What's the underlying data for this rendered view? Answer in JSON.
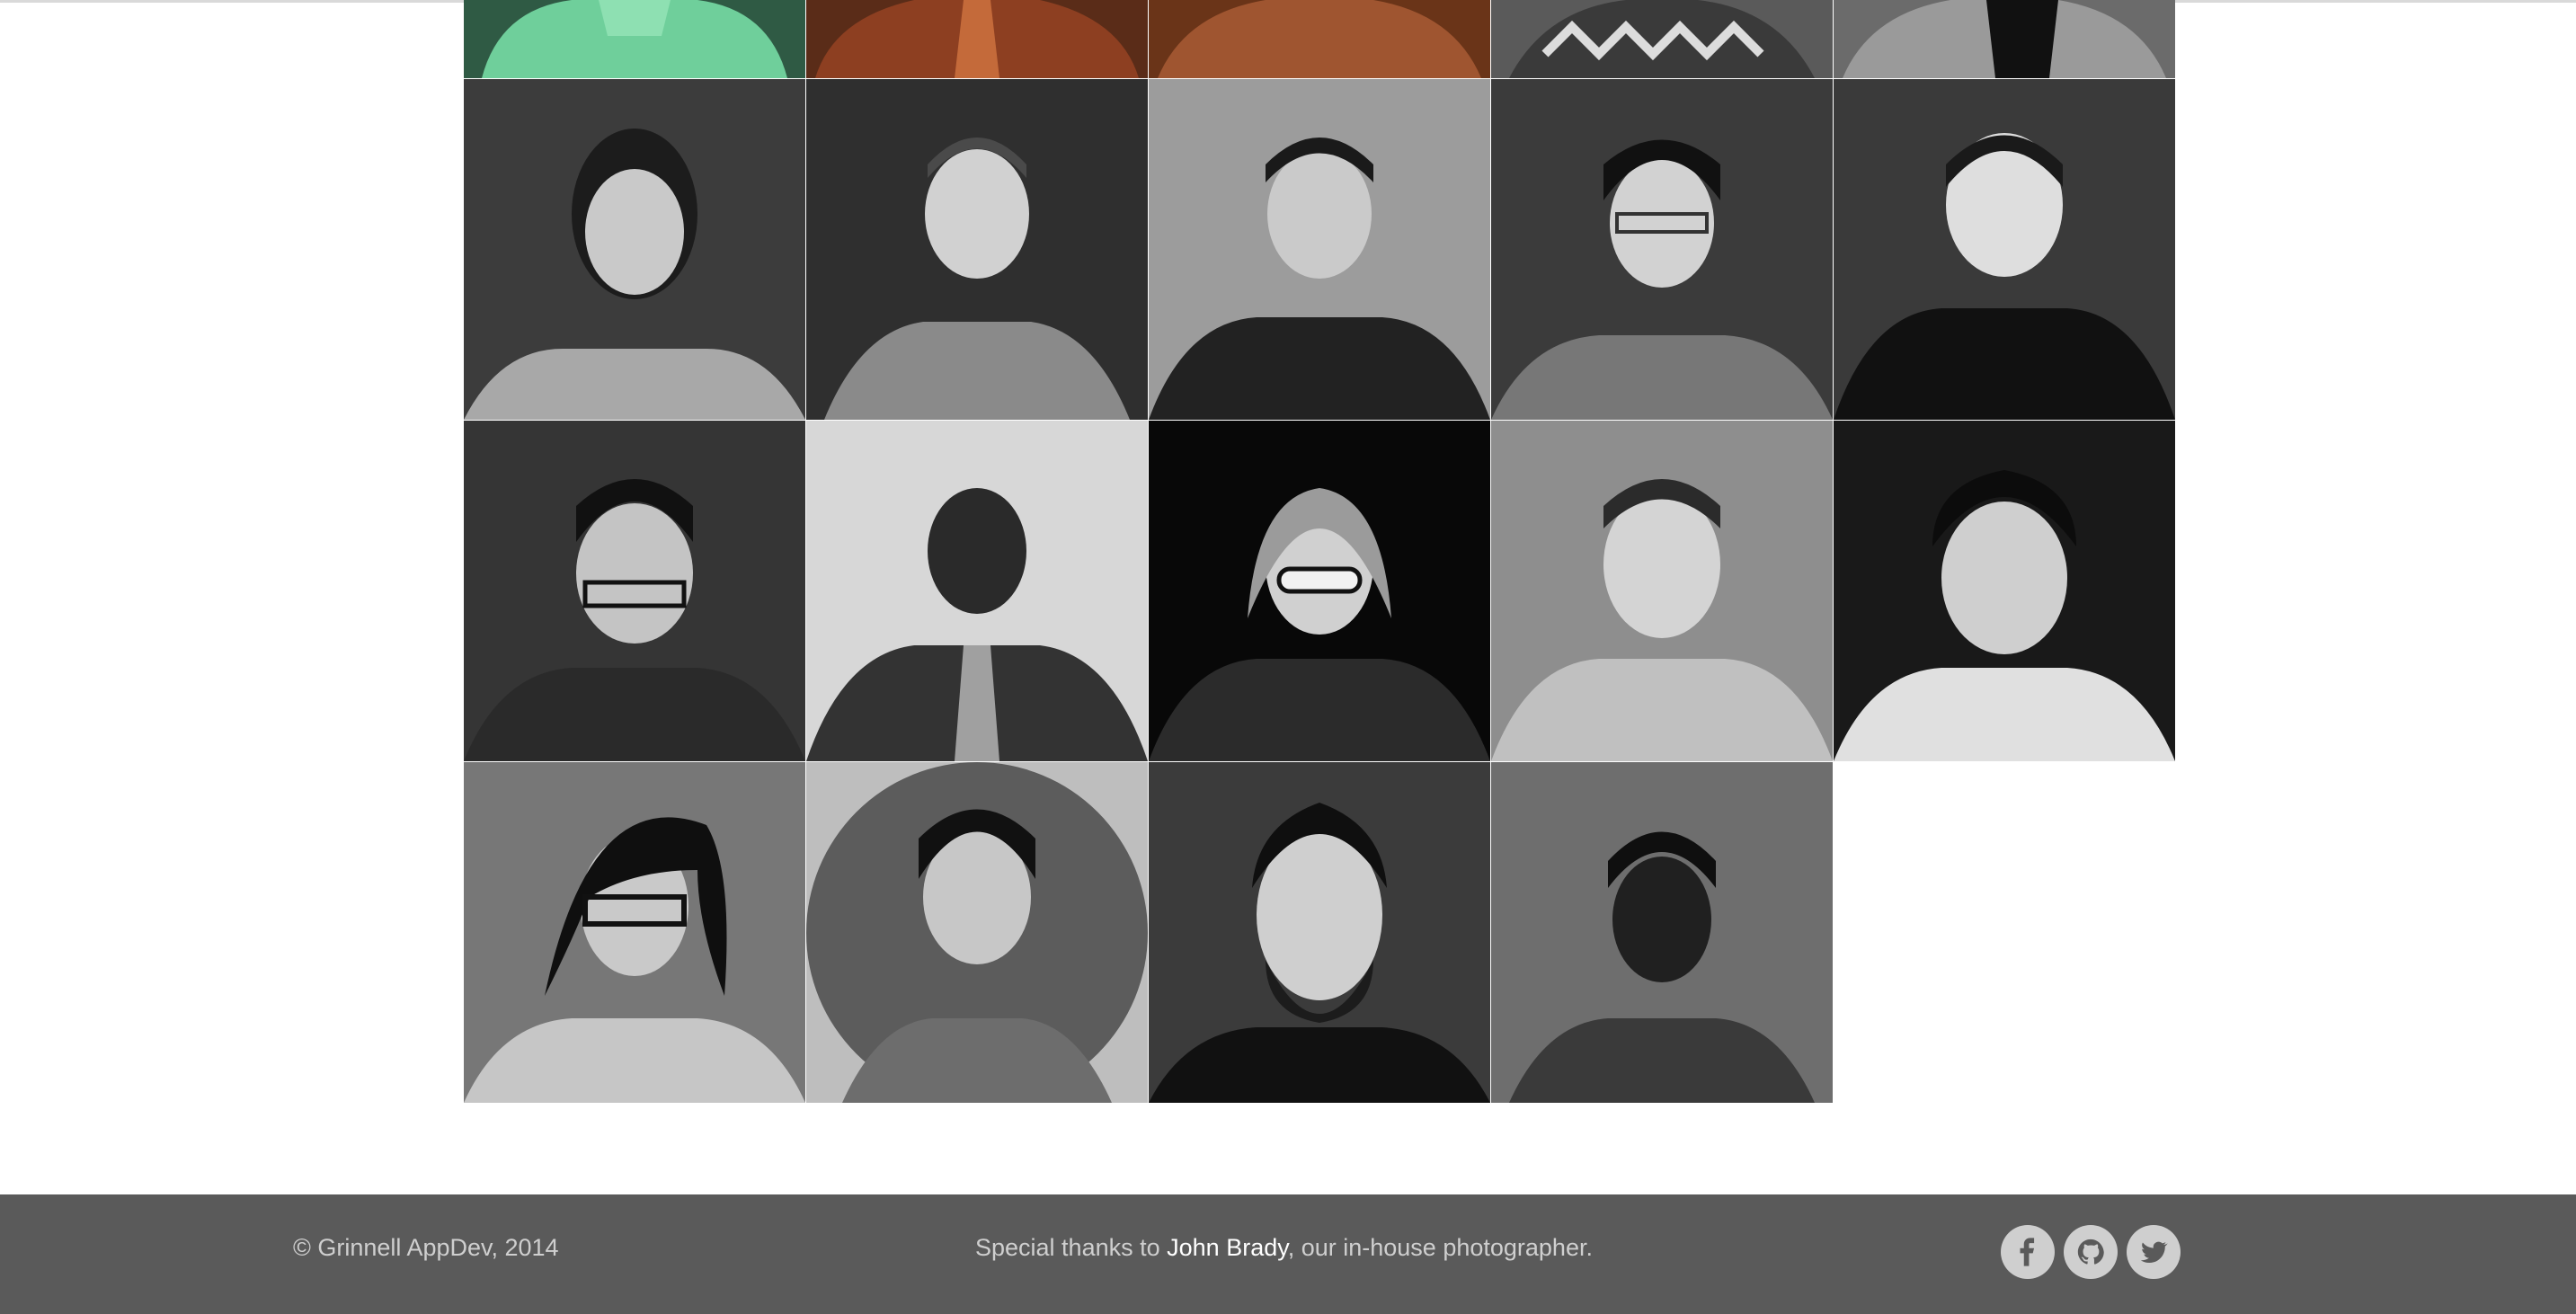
{
  "gallery": {
    "rows": 4,
    "columns": 5,
    "tiles": [
      {
        "icon": "person-photo",
        "tone": "color"
      },
      {
        "icon": "person-photo",
        "tone": "color"
      },
      {
        "icon": "person-photo",
        "tone": "color"
      },
      {
        "icon": "person-photo",
        "tone": "color"
      },
      {
        "icon": "person-photo",
        "tone": "color"
      },
      {
        "icon": "person-photo",
        "tone": "grayscale"
      },
      {
        "icon": "person-photo",
        "tone": "grayscale"
      },
      {
        "icon": "person-photo",
        "tone": "grayscale"
      },
      {
        "icon": "person-photo",
        "tone": "grayscale"
      },
      {
        "icon": "person-photo",
        "tone": "grayscale"
      },
      {
        "icon": "person-photo",
        "tone": "grayscale"
      },
      {
        "icon": "person-photo",
        "tone": "grayscale"
      },
      {
        "icon": "person-photo",
        "tone": "grayscale"
      },
      {
        "icon": "person-photo",
        "tone": "grayscale"
      },
      {
        "icon": "person-photo",
        "tone": "grayscale"
      },
      {
        "icon": "person-photo",
        "tone": "grayscale"
      },
      {
        "icon": "person-photo",
        "tone": "grayscale",
        "shape": "circle"
      },
      {
        "icon": "person-photo",
        "tone": "grayscale"
      },
      {
        "icon": "person-photo",
        "tone": "grayscale"
      }
    ]
  },
  "footer": {
    "copyright": "© Grinnell AppDev, 2014",
    "thanks_prefix": "Special thanks to ",
    "thanks_name": "John Brady",
    "thanks_suffix": ", our in-house photographer.",
    "social": [
      {
        "icon": "facebook-icon"
      },
      {
        "icon": "github-icon"
      },
      {
        "icon": "twitter-icon"
      }
    ]
  },
  "colors": {
    "footer_bg": "#5a5a5a",
    "footer_text": "#cfcfcf",
    "highlight_text": "#ffffff"
  }
}
